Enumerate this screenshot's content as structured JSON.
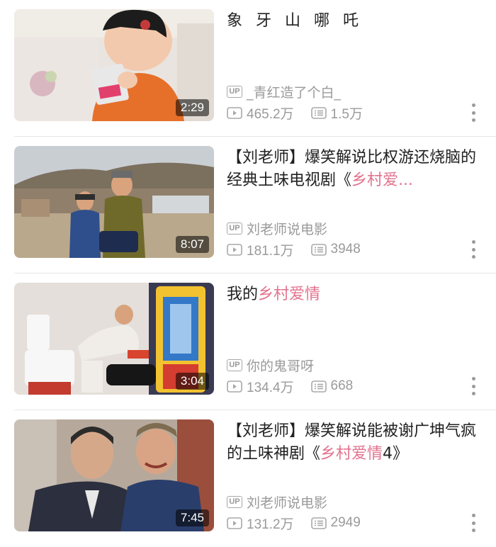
{
  "colors": {
    "highlight": "#e3738e",
    "meta": "#9a9a9a",
    "title": "#212121"
  },
  "videos": [
    {
      "title_parts": [
        "象 牙 山 哪 吒"
      ],
      "highlight": "",
      "title_suffix": "",
      "uploader": "_青红造了个白_",
      "views": "465.2万",
      "comments": "1.5万",
      "duration": "2:29"
    },
    {
      "title_parts": [
        "【刘老师】爆笑解说比权游还烧脑的经典土味电视剧《"
      ],
      "highlight": "乡村爱...",
      "title_suffix": "",
      "uploader": "刘老师说电影",
      "views": "181.1万",
      "comments": "3948",
      "duration": "8:07"
    },
    {
      "title_parts": [
        "我的"
      ],
      "highlight": "乡村爱情",
      "title_suffix": "",
      "uploader": "你的鬼哥呀",
      "views": "134.4万",
      "comments": "668",
      "duration": "3:04"
    },
    {
      "title_parts": [
        "【刘老师】爆笑解说能被谢广坤气疯的土味神剧《"
      ],
      "highlight": "乡村爱情",
      "title_suffix": "4》",
      "uploader": "刘老师说电影",
      "views": "131.2万",
      "comments": "2949",
      "duration": "7:45"
    }
  ],
  "badges": {
    "up": "UP"
  },
  "icons": {
    "views": "play-count-icon",
    "comments": "comment-count-icon",
    "more": "more-vertical-icon"
  }
}
